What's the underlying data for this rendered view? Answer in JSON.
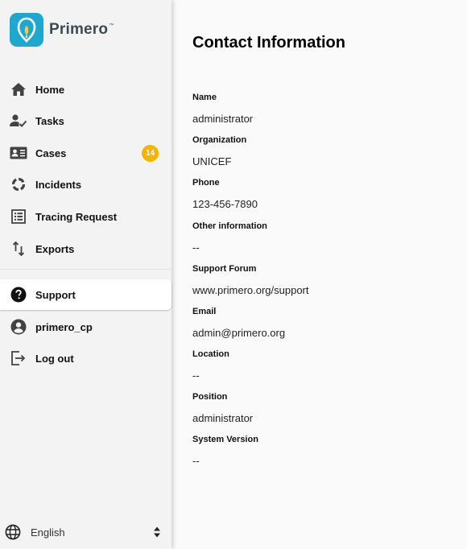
{
  "brand": {
    "name": "Primero",
    "trademark": "™",
    "accent_color": "#1ea7cf"
  },
  "sidebar": {
    "items": [
      {
        "label": "Home",
        "icon": "home-icon"
      },
      {
        "label": "Tasks",
        "icon": "tasks-icon"
      },
      {
        "label": "Cases",
        "icon": "cases-icon",
        "badge": "14"
      },
      {
        "label": "Incidents",
        "icon": "incidents-icon"
      },
      {
        "label": "Tracing Request",
        "icon": "tracing-request-icon"
      },
      {
        "label": "Exports",
        "icon": "exports-icon"
      }
    ],
    "secondary": [
      {
        "label": "Support",
        "icon": "help-icon",
        "active": true
      },
      {
        "label": "primero_cp",
        "icon": "account-icon"
      },
      {
        "label": "Log out",
        "icon": "logout-icon"
      }
    ],
    "language": {
      "selected": "English",
      "icon": "globe-icon"
    },
    "badge_color": "#f5b400"
  },
  "main": {
    "title": "Contact Information",
    "fields": [
      {
        "label": "Name",
        "value": "administrator"
      },
      {
        "label": "Organization",
        "value": "UNICEF"
      },
      {
        "label": "Phone",
        "value": "123-456-7890"
      },
      {
        "label": "Other information",
        "value": "--"
      },
      {
        "label": "Support Forum",
        "value": "www.primero.org/support"
      },
      {
        "label": "Email",
        "value": "admin@primero.org"
      },
      {
        "label": "Location",
        "value": "--"
      },
      {
        "label": "Position",
        "value": "administrator"
      },
      {
        "label": "System Version",
        "value": "--"
      }
    ]
  }
}
